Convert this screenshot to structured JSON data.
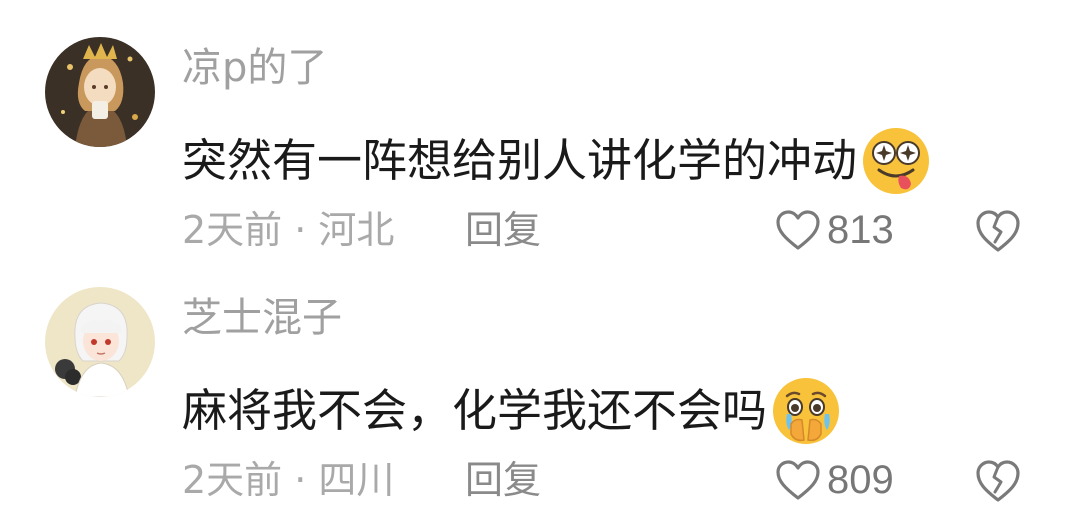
{
  "comments": [
    {
      "username": "凉p的了",
      "text": "突然有一阵想给别人讲化学的冲动",
      "emoji": "starry-eyed-tongue-emoji",
      "meta": "2天前 · 河北",
      "reply_label": "回复",
      "likes": "813",
      "like_icon": "heart-outline-icon",
      "dislike_icon": "broken-heart-icon",
      "avatar": "anime-avatar-girl-with-crown"
    },
    {
      "username": "芝士混子",
      "text": "麻将我不会，化学我还不会吗",
      "emoji": "teary-eyed-hands-over-mouth-emoji",
      "meta": "2天前 · 四川",
      "reply_label": "回复",
      "likes": "809",
      "like_icon": "heart-outline-icon",
      "dislike_icon": "broken-heart-icon",
      "avatar": "anime-avatar-white-hair-boy"
    }
  ],
  "colors": {
    "username": "#a0a0a0",
    "text": "#1a1a1a",
    "meta": "#a9a9a9",
    "icon": "#7a7a7a",
    "emoji_yellow": "#f8c23a"
  }
}
